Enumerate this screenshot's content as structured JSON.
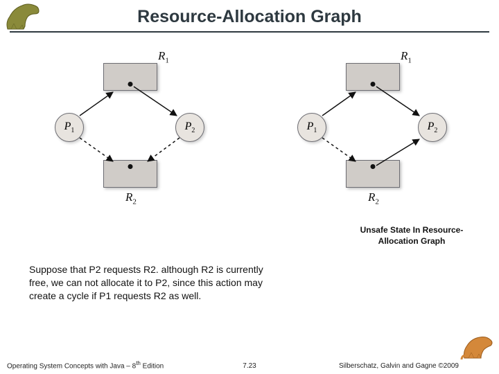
{
  "title": "Resource-Allocation Graph",
  "labels": {
    "R1": "R",
    "R1sub": "1",
    "R2": "R",
    "R2sub": "2",
    "P1": "P",
    "P1sub": "1",
    "P2": "P",
    "P2sub": "2"
  },
  "caption": "Unsafe State In Resource-Allocation Graph",
  "body": "Suppose that P2 requests R2. although R2 is currently free, we can not allocate it to P2, since this action may create a cycle if P1 requests R2 as well.",
  "footer": {
    "left_a": "Operating System Concepts with Java – 8",
    "left_b": " Edition",
    "left_sup": "th",
    "center": "7.23",
    "right": "Silberschatz, Galvin and Gagne ©2009"
  }
}
